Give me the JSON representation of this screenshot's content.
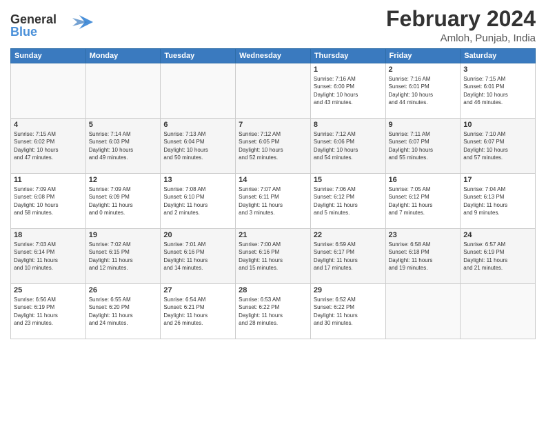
{
  "header": {
    "logo_line1": "General",
    "logo_line2": "Blue",
    "month_year": "February 2024",
    "location": "Amloh, Punjab, India"
  },
  "weekdays": [
    "Sunday",
    "Monday",
    "Tuesday",
    "Wednesday",
    "Thursday",
    "Friday",
    "Saturday"
  ],
  "weeks": [
    [
      {
        "day": "",
        "info": ""
      },
      {
        "day": "",
        "info": ""
      },
      {
        "day": "",
        "info": ""
      },
      {
        "day": "",
        "info": ""
      },
      {
        "day": "1",
        "info": "Sunrise: 7:16 AM\nSunset: 6:00 PM\nDaylight: 10 hours\nand 43 minutes."
      },
      {
        "day": "2",
        "info": "Sunrise: 7:16 AM\nSunset: 6:01 PM\nDaylight: 10 hours\nand 44 minutes."
      },
      {
        "day": "3",
        "info": "Sunrise: 7:15 AM\nSunset: 6:01 PM\nDaylight: 10 hours\nand 46 minutes."
      }
    ],
    [
      {
        "day": "4",
        "info": "Sunrise: 7:15 AM\nSunset: 6:02 PM\nDaylight: 10 hours\nand 47 minutes."
      },
      {
        "day": "5",
        "info": "Sunrise: 7:14 AM\nSunset: 6:03 PM\nDaylight: 10 hours\nand 49 minutes."
      },
      {
        "day": "6",
        "info": "Sunrise: 7:13 AM\nSunset: 6:04 PM\nDaylight: 10 hours\nand 50 minutes."
      },
      {
        "day": "7",
        "info": "Sunrise: 7:12 AM\nSunset: 6:05 PM\nDaylight: 10 hours\nand 52 minutes."
      },
      {
        "day": "8",
        "info": "Sunrise: 7:12 AM\nSunset: 6:06 PM\nDaylight: 10 hours\nand 54 minutes."
      },
      {
        "day": "9",
        "info": "Sunrise: 7:11 AM\nSunset: 6:07 PM\nDaylight: 10 hours\nand 55 minutes."
      },
      {
        "day": "10",
        "info": "Sunrise: 7:10 AM\nSunset: 6:07 PM\nDaylight: 10 hours\nand 57 minutes."
      }
    ],
    [
      {
        "day": "11",
        "info": "Sunrise: 7:09 AM\nSunset: 6:08 PM\nDaylight: 10 hours\nand 58 minutes."
      },
      {
        "day": "12",
        "info": "Sunrise: 7:09 AM\nSunset: 6:09 PM\nDaylight: 11 hours\nand 0 minutes."
      },
      {
        "day": "13",
        "info": "Sunrise: 7:08 AM\nSunset: 6:10 PM\nDaylight: 11 hours\nand 2 minutes."
      },
      {
        "day": "14",
        "info": "Sunrise: 7:07 AM\nSunset: 6:11 PM\nDaylight: 11 hours\nand 3 minutes."
      },
      {
        "day": "15",
        "info": "Sunrise: 7:06 AM\nSunset: 6:12 PM\nDaylight: 11 hours\nand 5 minutes."
      },
      {
        "day": "16",
        "info": "Sunrise: 7:05 AM\nSunset: 6:12 PM\nDaylight: 11 hours\nand 7 minutes."
      },
      {
        "day": "17",
        "info": "Sunrise: 7:04 AM\nSunset: 6:13 PM\nDaylight: 11 hours\nand 9 minutes."
      }
    ],
    [
      {
        "day": "18",
        "info": "Sunrise: 7:03 AM\nSunset: 6:14 PM\nDaylight: 11 hours\nand 10 minutes."
      },
      {
        "day": "19",
        "info": "Sunrise: 7:02 AM\nSunset: 6:15 PM\nDaylight: 11 hours\nand 12 minutes."
      },
      {
        "day": "20",
        "info": "Sunrise: 7:01 AM\nSunset: 6:16 PM\nDaylight: 11 hours\nand 14 minutes."
      },
      {
        "day": "21",
        "info": "Sunrise: 7:00 AM\nSunset: 6:16 PM\nDaylight: 11 hours\nand 15 minutes."
      },
      {
        "day": "22",
        "info": "Sunrise: 6:59 AM\nSunset: 6:17 PM\nDaylight: 11 hours\nand 17 minutes."
      },
      {
        "day": "23",
        "info": "Sunrise: 6:58 AM\nSunset: 6:18 PM\nDaylight: 11 hours\nand 19 minutes."
      },
      {
        "day": "24",
        "info": "Sunrise: 6:57 AM\nSunset: 6:19 PM\nDaylight: 11 hours\nand 21 minutes."
      }
    ],
    [
      {
        "day": "25",
        "info": "Sunrise: 6:56 AM\nSunset: 6:19 PM\nDaylight: 11 hours\nand 23 minutes."
      },
      {
        "day": "26",
        "info": "Sunrise: 6:55 AM\nSunset: 6:20 PM\nDaylight: 11 hours\nand 24 minutes."
      },
      {
        "day": "27",
        "info": "Sunrise: 6:54 AM\nSunset: 6:21 PM\nDaylight: 11 hours\nand 26 minutes."
      },
      {
        "day": "28",
        "info": "Sunrise: 6:53 AM\nSunset: 6:22 PM\nDaylight: 11 hours\nand 28 minutes."
      },
      {
        "day": "29",
        "info": "Sunrise: 6:52 AM\nSunset: 6:22 PM\nDaylight: 11 hours\nand 30 minutes."
      },
      {
        "day": "",
        "info": ""
      },
      {
        "day": "",
        "info": ""
      }
    ]
  ]
}
